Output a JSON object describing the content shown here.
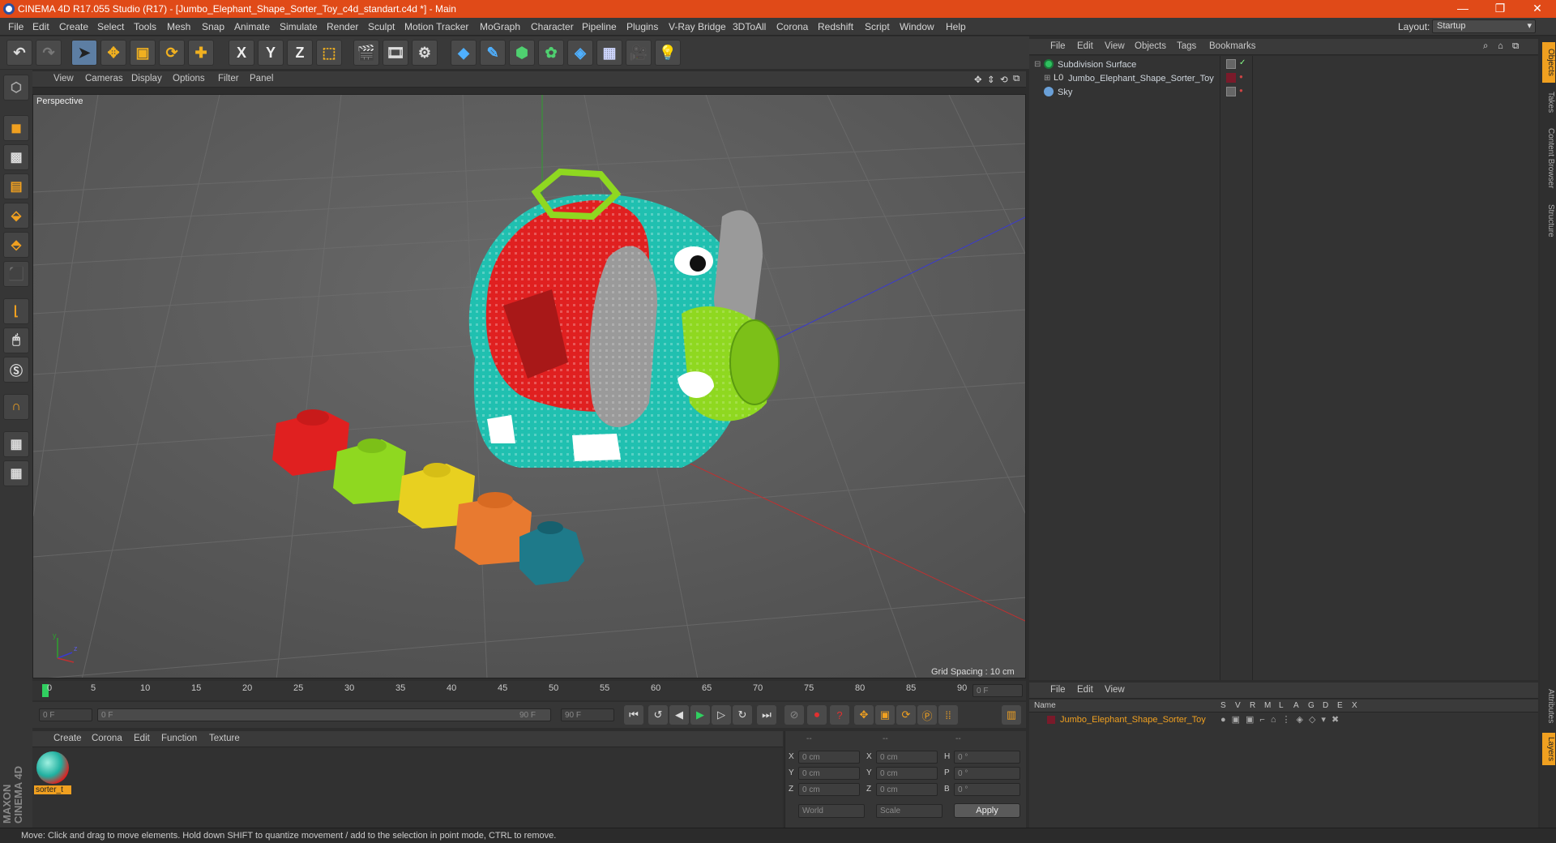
{
  "window": {
    "title": "CINEMA 4D R17.055 Studio (R17) - [Jumbo_Elephant_Shape_Sorter_Toy_c4d_standart.c4d *] - Main",
    "minimize": "—",
    "restore": "❐",
    "close": "✕"
  },
  "menubar": {
    "items": [
      "File",
      "Edit",
      "Create",
      "Select",
      "Tools",
      "Mesh",
      "Snap",
      "Animate",
      "Simulate",
      "Render",
      "Sculpt",
      "Motion Tracker",
      "MoGraph",
      "Character",
      "Pipeline",
      "Plugins",
      "V-Ray Bridge",
      "3DToAll",
      "Corona",
      "Redshift",
      "Script",
      "Window",
      "Help"
    ],
    "layout_label": "Layout:",
    "layout_value": "Startup"
  },
  "toolbar": {
    "axis_x": "X",
    "axis_y": "Y",
    "axis_z": "Z"
  },
  "viewport": {
    "menu": [
      "View",
      "Cameras",
      "Display",
      "Options",
      "Filter",
      "Panel"
    ],
    "camera_label": "Perspective",
    "grid_spacing": "Grid Spacing : 10 cm",
    "axis_y": "y",
    "axis_z": "z"
  },
  "object_manager": {
    "menu": [
      "File",
      "Edit",
      "View",
      "Objects",
      "Tags",
      "Bookmarks"
    ],
    "objects": [
      {
        "name": "Subdivision Surface",
        "icon": "subdivision-icon"
      },
      {
        "name": "Jumbo_Elephant_Shape_Sorter_Toy",
        "icon": "null-object-icon"
      },
      {
        "name": "Sky",
        "icon": "sky-icon"
      }
    ],
    "side_tabs": [
      "Objects",
      "Takes",
      "Content Browser",
      "Structure"
    ]
  },
  "timeline": {
    "ticks": [
      "0",
      "5",
      "10",
      "15",
      "20",
      "25",
      "30",
      "35",
      "40",
      "45",
      "50",
      "55",
      "60",
      "65",
      "70",
      "75",
      "80",
      "85",
      "90"
    ],
    "current_frame_display": "0 F",
    "start_field": "0 F",
    "range_start": "0 F",
    "range_end": "90 F",
    "end_field": "90 F"
  },
  "material_manager": {
    "menu": [
      "Create",
      "Corona",
      "Edit",
      "Function",
      "Texture"
    ],
    "material_name": "sorter_t"
  },
  "coordinates": {
    "headers": [
      "--",
      "--",
      "--"
    ],
    "rows": [
      {
        "l1": "X",
        "v1": "0 cm",
        "l2": "X",
        "v2": "0 cm",
        "l3": "H",
        "v3": "0 °"
      },
      {
        "l1": "Y",
        "v1": "0 cm",
        "l2": "Y",
        "v2": "0 cm",
        "l3": "P",
        "v3": "0 °"
      },
      {
        "l1": "Z",
        "v1": "0 cm",
        "l2": "Z",
        "v2": "0 cm",
        "l3": "B",
        "v3": "0 °"
      }
    ],
    "mode_select": "World",
    "transform_select": "Scale",
    "apply_label": "Apply"
  },
  "layer_manager": {
    "menu": [
      "File",
      "Edit",
      "View"
    ],
    "name_header": "Name",
    "column_flags": [
      "S",
      "V",
      "R",
      "M",
      "L",
      "A",
      "G",
      "D",
      "E",
      "X"
    ],
    "layers": [
      {
        "name": "Jumbo_Elephant_Shape_Sorter_Toy"
      }
    ],
    "side_tabs": [
      "Attributes",
      "Layers"
    ]
  },
  "status_bar": {
    "text": "Move: Click and drag to move elements. Hold down SHIFT to quantize movement / add to the selection in point mode, CTRL to remove."
  },
  "branding": {
    "logo_text": "MAXON CINEMA 4D"
  },
  "colors": {
    "title_bar": "#e04a18",
    "accent_orange": "#f0a020",
    "layer_red": "#7a1a2a",
    "selected_blue": "#5d7ea3"
  }
}
